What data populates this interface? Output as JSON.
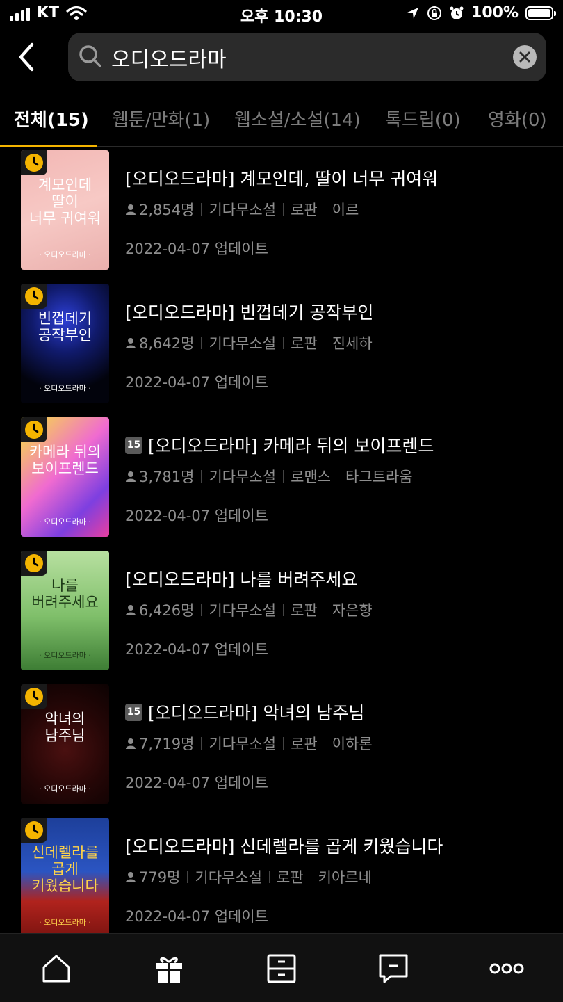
{
  "status_bar": {
    "carrier": "KT",
    "time": "오후 10:30",
    "battery": "100%"
  },
  "search": {
    "query": "오디오드라마"
  },
  "tabs": [
    {
      "label": "전체(15)"
    },
    {
      "label": "웹툰/만화(1)"
    },
    {
      "label": "웹소설/소설(14)"
    },
    {
      "label": "톡드립(0)"
    },
    {
      "label": "영화(0)"
    }
  ],
  "items": [
    {
      "title": "[오디오드라마] 계모인데, 딸이 너무 귀여워",
      "readers": "2,854명",
      "category": "기다무소설",
      "genre": "로판",
      "author": "이르",
      "updated": "2022-04-07 업데이트",
      "age": "",
      "cover_title": "계모인데\n딸이\n너무 귀여워",
      "cover_brand": "· 오디오드라마 ·",
      "cover_bg": "linear-gradient(160deg,#f2b7b4 0%,#f7c9c5 50%,#eab0ad 100%)",
      "cover_fg": "#ffffff"
    },
    {
      "title": "[오디오드라마] 빈껍데기 공작부인",
      "readers": "8,642명",
      "category": "기다무소설",
      "genre": "로판",
      "author": "진세하",
      "updated": "2022-04-07 업데이트",
      "age": "",
      "cover_title": "빈껍데기\n공작부인",
      "cover_brand": "· 오디오드라마 ·",
      "cover_bg": "radial-gradient(circle at 50% 30%,#2d3fd6 0%,#101a6b 35%,#02030c 75%)",
      "cover_fg": "#ffffff"
    },
    {
      "title": "[오디오드라마] 카메라 뒤의 보이프렌드",
      "readers": "3,781명",
      "category": "기다무소설",
      "genre": "로맨스",
      "author": "타그트라움",
      "updated": "2022-04-07 업데이트",
      "age": "15",
      "cover_title": "카메라 뒤의\n보이프렌드",
      "cover_brand": "· 오디오드라마 ·",
      "cover_bg": "linear-gradient(135deg,#f7e63a 0%,#f06bd0 45%,#7d3fe0 75%,#e83fa0 100%)",
      "cover_fg": "#ffffff"
    },
    {
      "title": "[오디오드라마] 나를 버려주세요",
      "readers": "6,426명",
      "category": "기다무소설",
      "genre": "로판",
      "author": "자은향",
      "updated": "2022-04-07 업데이트",
      "age": "",
      "cover_title": "나를\n버려주세요",
      "cover_brand": "· 오디오드라마 ·",
      "cover_bg": "linear-gradient(180deg,#b8e0a0 0%,#7fbf6a 55%,#3d7d34 100%)",
      "cover_fg": "#1d3a17"
    },
    {
      "title": "[오디오드라마] 악녀의 남주님",
      "readers": "7,719명",
      "category": "기다무소설",
      "genre": "로판",
      "author": "이하론",
      "updated": "2022-04-07 업데이트",
      "age": "15",
      "cover_title": "악녀의\n남주님",
      "cover_brand": "· 오디오드라마 ·",
      "cover_bg": "radial-gradient(circle at 50% 55%,#4a1010 0%,#240606 55%,#0c0202 100%)",
      "cover_fg": "#ffffff"
    },
    {
      "title": "[오디오드라마] 신데렐라를 곱게 키웠습니다",
      "readers": "779명",
      "category": "기다무소설",
      "genre": "로판",
      "author": "키아르네",
      "updated": "2022-04-07 업데이트",
      "age": "",
      "cover_title": "신데렐라를\n곱게\n키웠습니다",
      "cover_brand": "· 오디오드라마 ·",
      "cover_bg": "linear-gradient(180deg,#1d3f9a 0%,#2b55c2 45%,#b0231d 70%,#7d1410 100%)",
      "cover_fg": "#ffd34a"
    }
  ],
  "colors": {
    "accent": "#f4b400",
    "background": "#000000",
    "muted_text": "#8e8e8e"
  },
  "nav": [
    {
      "icon": "home-icon"
    },
    {
      "icon": "gift-icon"
    },
    {
      "icon": "drawer-icon"
    },
    {
      "icon": "message-icon"
    },
    {
      "icon": "more-icon"
    }
  ]
}
